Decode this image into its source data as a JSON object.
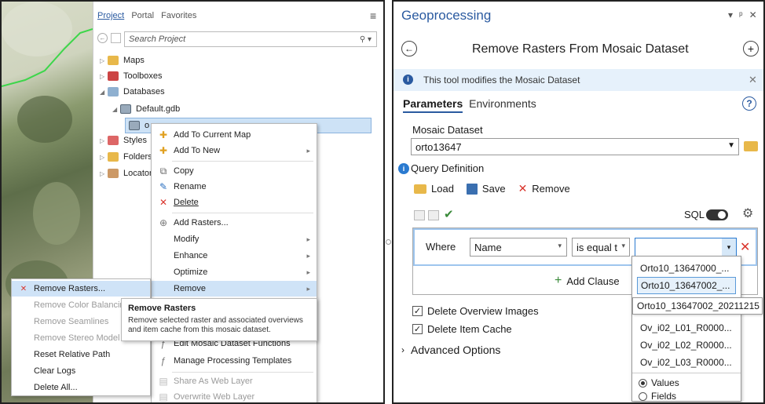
{
  "catalog": {
    "tabs": [
      "Project",
      "Portal",
      "Favorites"
    ],
    "search_placeholder": "Search Project",
    "tree": {
      "maps": "Maps",
      "toolboxes": "Toolboxes",
      "databases": "Databases",
      "default_gdb": "Default.gdb",
      "selected_item": "o",
      "styles": "Styles",
      "folders": "Folders",
      "locators": "Locator"
    }
  },
  "context_menu": {
    "items": [
      {
        "label": "Add To Current Map",
        "icon": "add-map-icon",
        "arrow": false
      },
      {
        "label": "Add To New",
        "icon": "add-new-icon",
        "arrow": true
      },
      {
        "label": "Copy",
        "icon": "copy-icon",
        "arrow": false
      },
      {
        "label": "Rename",
        "icon": "rename-icon",
        "arrow": false
      },
      {
        "label": "Delete",
        "icon": "delete-icon",
        "arrow": false
      },
      {
        "label": "Add Rasters...",
        "icon": "add-rasters-icon",
        "arrow": false
      },
      {
        "label": "Modify",
        "icon": "",
        "arrow": true
      },
      {
        "label": "Enhance",
        "icon": "",
        "arrow": true
      },
      {
        "label": "Optimize",
        "icon": "",
        "arrow": true
      },
      {
        "label": "Remove",
        "icon": "",
        "arrow": true
      },
      {
        "label": "Edit Mosaic Dataset Functions",
        "icon": "functions-icon",
        "arrow": false
      },
      {
        "label": "Manage Processing Templates",
        "icon": "templates-icon",
        "arrow": false
      },
      {
        "label": "Share As Web Layer",
        "icon": "share-icon",
        "arrow": false
      },
      {
        "label": "Overwrite Web Layer",
        "icon": "overwrite-icon",
        "arrow": false
      }
    ]
  },
  "remove_submenu": {
    "items": [
      "Remove Rasters...",
      "Remove Color Balancin",
      "Remove Seamlines",
      "Remove Stereo Model",
      "Reset Relative Path",
      "Clear Logs",
      "Delete All..."
    ]
  },
  "tooltip": {
    "title": "Remove Rasters",
    "body": "Remove selected raster and associated overviews and item cache from this mosaic dataset."
  },
  "geoprocessing": {
    "pane_title": "Geoprocessing",
    "pane_controls": [
      "▾",
      "ᵖ",
      "✕"
    ],
    "tool_title": "Remove Rasters From Mosaic Dataset",
    "info_message": "This tool modifies the Mosaic Dataset",
    "tabs": [
      "Parameters",
      "Environments"
    ],
    "mosaic_dataset_label": "Mosaic Dataset",
    "mosaic_dataset_value": "orto13647",
    "query_definition_label": "Query Definition",
    "load": "Load",
    "save": "Save",
    "remove": "Remove",
    "sql_label": "SQL",
    "where_label": "Where",
    "field_value": "Name",
    "operator_value": "is equal t",
    "add_clause": "Add Clause",
    "delete_overview_images": "Delete Overview Images",
    "delete_item_cache": "Delete Item Cache",
    "advanced_options": "Advanced Options"
  },
  "value_dropdown": {
    "items": [
      "Orto10_13647000_...",
      "Orto10_13647002_...",
      "Orto10_13647002_20211215",
      "Ov_i02_L01_R0000...",
      "Ov_i02_L02_R0000...",
      "Ov_i02_L03_R0000..."
    ],
    "radio_values": "Values",
    "radio_fields": "Fields"
  },
  "colors": {
    "accent": "#2a5aa0",
    "menu_selected": "#cfe3f7",
    "info_bar": "#e6f1fb",
    "remove_red": "#d9332b",
    "add_green": "#3a8a3a"
  }
}
